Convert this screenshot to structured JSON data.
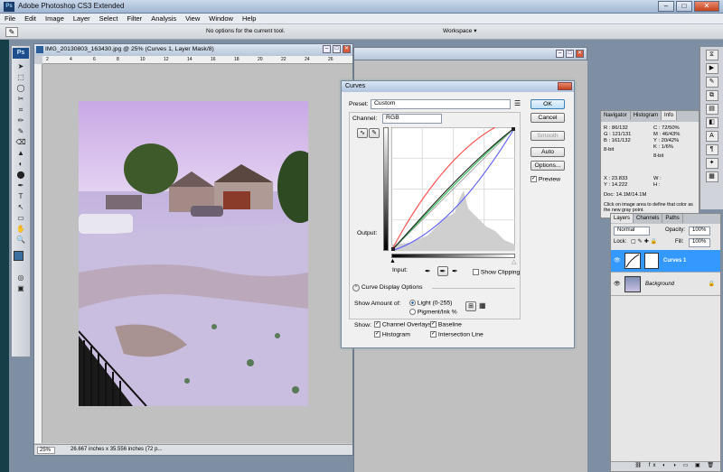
{
  "app": {
    "title": "Adobe Photoshop CS3 Extended",
    "icon": "Ps",
    "menu": [
      "File",
      "Edit",
      "Image",
      "Layer",
      "Select",
      "Filter",
      "Analysis",
      "View",
      "Window",
      "Help"
    ],
    "options_message": "No options for the current tool.",
    "workspace_label": "Workspace ▾"
  },
  "toolbox": {
    "logo": "Ps",
    "tools": [
      "➤",
      "⬚",
      "◯",
      "✂",
      "⌗",
      "✏",
      "✎",
      "⌫",
      "▲",
      "◐",
      "⬤",
      "✒",
      "T",
      "↖",
      "▭",
      "✋",
      "🔍"
    ]
  },
  "document": {
    "title": "IMG_20130803_163430.jpg @ 25% (Curves 1, Layer Mask/8)",
    "zoom": "25%",
    "info": "26.667 inches x 35.556 inches (72 p...",
    "ruler_marks": [
      "2",
      "4",
      "6",
      "8",
      "10",
      "12",
      "14",
      "16",
      "18",
      "20",
      "22",
      "24",
      "26"
    ]
  },
  "curves": {
    "title": "Curves",
    "preset_label": "Preset:",
    "preset_value": "Custom",
    "channel_label": "Channel:",
    "channel_value": "RGB",
    "output_label": "Output:",
    "input_label": "Input:",
    "show_clipping": "Show Clipping",
    "display_options": "Curve Display Options",
    "show_amount_label": "Show Amount of:",
    "light_option": "Light  (0-255)",
    "pigment_option": "Pigment/Ink %",
    "show_label": "Show:",
    "channel_overlays": "Channel Overlays",
    "baseline": "Baseline",
    "histogram": "Histogram",
    "intersection_line": "Intersection Line",
    "buttons": {
      "ok": "OK",
      "cancel": "Cancel",
      "smooth": "Smooth",
      "auto": "Auto",
      "options": "Options..."
    },
    "preview": "Preview",
    "curve_colors": {
      "red": "#ff4d4d",
      "green": "#2db84d",
      "blue": "#5a5aff",
      "rgb": "#222222"
    }
  },
  "info_panel": {
    "tabs": [
      "Navigator",
      "Histogram",
      "Info"
    ],
    "rgb": [
      [
        "R :",
        "86/",
        "132"
      ],
      [
        "G :",
        "121/",
        "131"
      ],
      [
        "B :",
        "161/",
        "132"
      ]
    ],
    "cmyk": [
      [
        "C :",
        "72/",
        "50%"
      ],
      [
        "M :",
        "46/",
        "43%"
      ],
      [
        "Y :",
        "20/",
        "42%"
      ],
      [
        "K :",
        "1/",
        "6%"
      ]
    ],
    "bit_left": "8-bit",
    "bit_right": "8-bit",
    "x": "23.833",
    "y": "14.222",
    "w": "W :",
    "h": "H :",
    "doc": "Doc: 14.1M/14.1M",
    "hint": "Click on image area to define that color as the new gray point."
  },
  "layers_panel": {
    "tabs": [
      "Layers",
      "Channels",
      "Paths"
    ],
    "blend_mode": "Normal",
    "opacity_label": "Opacity:",
    "opacity": "100%",
    "lock_label": "Lock:",
    "fill_label": "Fill:",
    "fill": "100%",
    "layers": [
      "Curves 1",
      "Background"
    ]
  }
}
